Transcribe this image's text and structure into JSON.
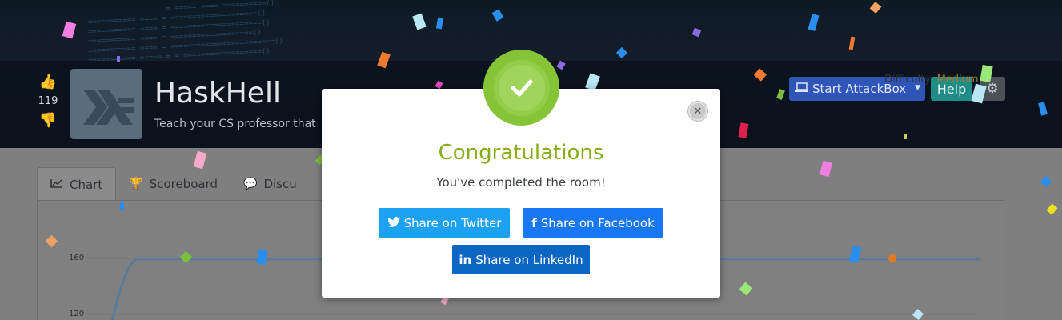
{
  "room": {
    "title": "HaskHell",
    "subtitle": "Teach your CS professor that",
    "votes": "119"
  },
  "header": {
    "attackbox_label": "Start AttackBox",
    "help_label": "Help"
  },
  "tabs": [
    {
      "label": "Chart",
      "icon": "line-chart-icon"
    },
    {
      "label": "Scoreboard",
      "icon": "trophy-icon"
    },
    {
      "label": "Discu",
      "icon": "comments-icon"
    }
  ],
  "chart": {
    "difficulty_label": "Difficulty:",
    "difficulty_value": "Medium",
    "y_ticks": [
      "160",
      "120"
    ]
  },
  "modal": {
    "title": "Congratulations",
    "message": "You've completed the room!",
    "share_twitter": "Share on Twitter",
    "share_facebook": "Share on Facebook",
    "share_linkedin": "Share on LinkedIn"
  },
  "colors": {
    "accent_green": "#85c436",
    "title_green": "#86ad13",
    "twitter": "#1da1f2",
    "facebook": "#1877f2",
    "linkedin": "#0a66c2",
    "difficulty_medium": "#a27b34"
  }
}
